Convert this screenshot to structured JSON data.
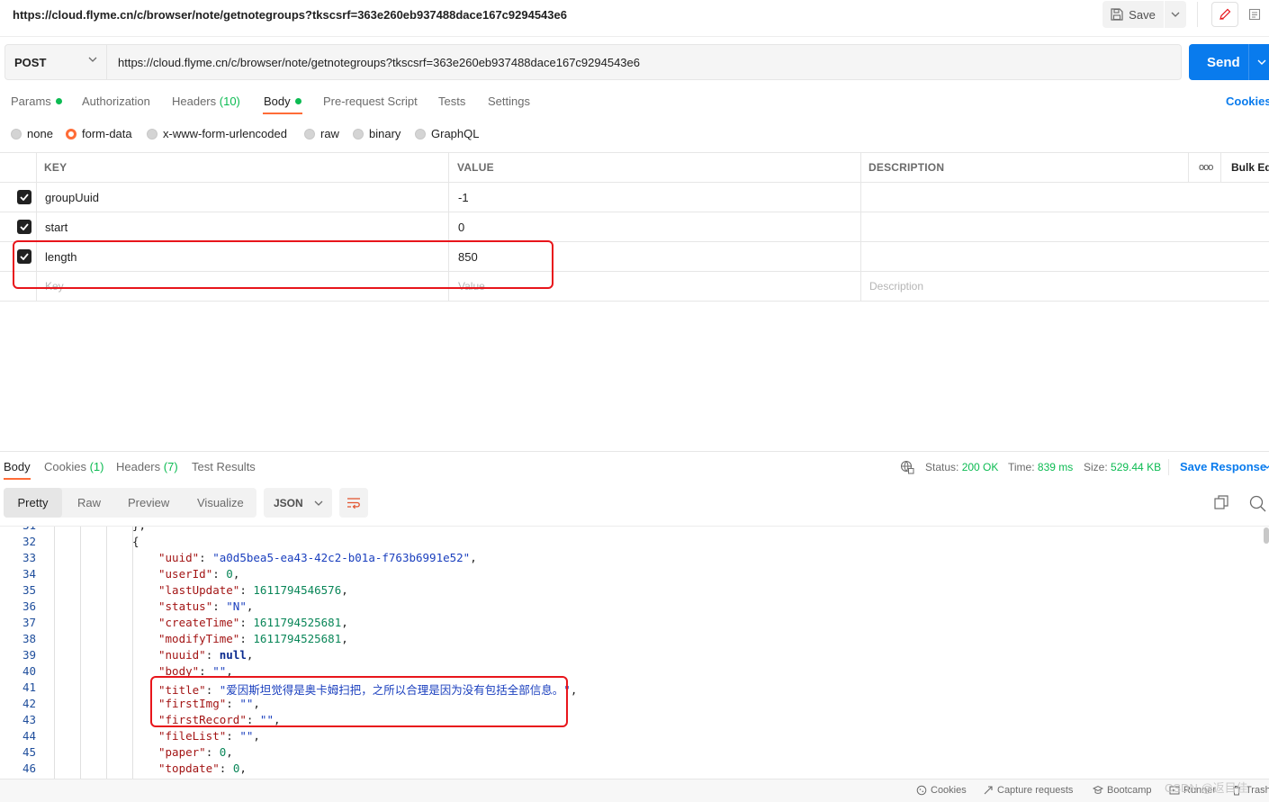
{
  "request": {
    "title": "https://cloud.flyme.cn/c/browser/note/getnotegroups?tkscsrf=363e260eb937488dace167c9294543e6",
    "save_label": "Save",
    "method": "POST",
    "url": "https://cloud.flyme.cn/c/browser/note/getnotegroups?tkscsrf=363e260eb937488dace167c9294543e6",
    "send_label": "Send",
    "cookies_label": "Cookies"
  },
  "tabs": {
    "params": "Params",
    "authorization": "Authorization",
    "headers": "Headers",
    "headers_count": "(10)",
    "body": "Body",
    "pre_request": "Pre-request Script",
    "tests": "Tests",
    "settings": "Settings"
  },
  "body_types": [
    "none",
    "form-data",
    "x-www-form-urlencoded",
    "raw",
    "binary",
    "GraphQL"
  ],
  "params_table": {
    "headers": {
      "key": "KEY",
      "value": "VALUE",
      "description": "DESCRIPTION",
      "more": "ooo",
      "bulk_edit": "Bulk Ed"
    },
    "rows": [
      {
        "key": "groupUuid",
        "value": "-1",
        "checked": true
      },
      {
        "key": "start",
        "value": "0",
        "checked": true
      },
      {
        "key": "length",
        "value": "850",
        "checked": true
      }
    ],
    "placeholder": {
      "key": "Key",
      "value": "Value",
      "description": "Description"
    }
  },
  "response": {
    "tabs": {
      "body": "Body",
      "cookies": "Cookies",
      "cookies_count": "(1)",
      "headers": "Headers",
      "headers_count": "(7)",
      "test_results": "Test Results"
    },
    "status_label": "Status:",
    "status_value": "200 OK",
    "time_label": "Time:",
    "time_value": "839 ms",
    "size_label": "Size:",
    "size_value": "529.44 KB",
    "save_response": "Save Response",
    "view_modes": [
      "Pretty",
      "Raw",
      "Preview",
      "Visualize"
    ],
    "format": "JSON"
  },
  "code": {
    "lines": [
      {
        "n": "31",
        "text": "},"
      },
      {
        "n": "32",
        "text": "{"
      },
      {
        "n": "33",
        "key": "uuid",
        "value": "\"a0d5bea5-ea43-42c2-b01a-f763b6991e52\"",
        "type": "s"
      },
      {
        "n": "34",
        "key": "userId",
        "value": "0",
        "type": "n"
      },
      {
        "n": "35",
        "key": "lastUpdate",
        "value": "1611794546576",
        "type": "n"
      },
      {
        "n": "36",
        "key": "status",
        "value": "\"N\"",
        "type": "s"
      },
      {
        "n": "37",
        "key": "createTime",
        "value": "1611794525681",
        "type": "n"
      },
      {
        "n": "38",
        "key": "modifyTime",
        "value": "1611794525681",
        "type": "n"
      },
      {
        "n": "39",
        "key": "nuuid",
        "value": "null",
        "type": "kw"
      },
      {
        "n": "40",
        "key": "body",
        "value": "\"\"",
        "type": "s"
      },
      {
        "n": "41",
        "key": "title",
        "value": "\"爱因斯坦觉得是奥卡姆扫把，之所以合理是因为没有包括全部信息。\"",
        "type": "s"
      },
      {
        "n": "42",
        "key": "firstImg",
        "value": "\"\"",
        "type": "s"
      },
      {
        "n": "43",
        "key": "firstRecord",
        "value": "\"\"",
        "type": "s"
      },
      {
        "n": "44",
        "key": "fileList",
        "value": "\"\"",
        "type": "s"
      },
      {
        "n": "45",
        "key": "paper",
        "value": "0",
        "type": "n"
      },
      {
        "n": "46",
        "key": "topdate",
        "value": "0",
        "type": "n"
      }
    ]
  },
  "footer": {
    "cookies": "Cookies",
    "capture": "Capture requests",
    "bootcamp": "Bootcamp",
    "runner": "Runner",
    "trash": "Trash",
    "watermark": "CSDN @返目佳"
  },
  "colors": {
    "accent": "#ff6c37",
    "primary": "#097bed",
    "success": "#0cbb52",
    "highlight_box": "#e8151b"
  }
}
